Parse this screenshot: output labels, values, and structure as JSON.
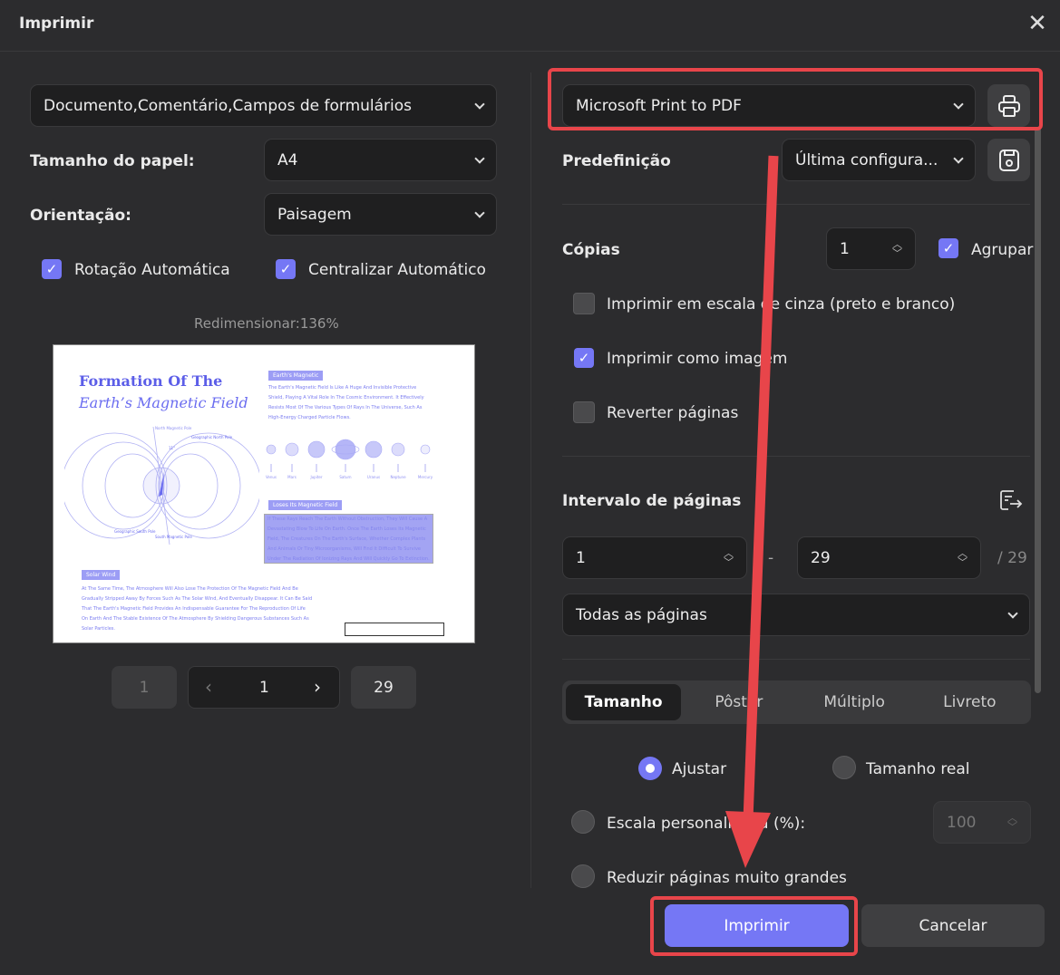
{
  "window": {
    "title": "Imprimir"
  },
  "left": {
    "content_select": "Documento,Comentário,Campos de formulários",
    "paper_size_label": "Tamanho do papel:",
    "paper_size": "A4",
    "orientation_label": "Orientação:",
    "orientation": "Paisagem",
    "auto_rotate": "Rotação Automática",
    "auto_center": "Centralizar Automático",
    "resize": "Redimensionar:136%",
    "pager": {
      "first": "1",
      "current": "1",
      "last": "29"
    }
  },
  "preview": {
    "title_line1": "Formation Of The",
    "title_line2": "Earth’s Magnetic Field",
    "tag1": "Earth's Magnetic",
    "para1": "The Earth's Magnetic Field Is Like A Huge And Invisible Protective Shield, Playing A Vital Role In The Cosmic Environment. It Effectively Resists Most Of The Various Types Of Rays In The Universe, Such As High-Energy Charged Particle Flows.",
    "planets": [
      "Venus",
      "Mars",
      "Jupiter",
      "Saturn",
      "Uranus",
      "Neptune",
      "Mercury"
    ],
    "tag2": "Loses Its Magnetic Field",
    "para2": "If These Rays Reach The Earth Without Obstruction, They Will Cause A Devastating Blow To Life On Earth. Once The Earth Loses Its Magnetic Field, The Creatures On The Earth's Surface, Whether Complex Plants And Animals Or Tiny Microorganisms, Will Find It Difficult To Survive Under The Radiation Of Ionizing Rays And Will Quickly Go To Extinction.",
    "tag3": "Solar Wind",
    "para3": "At The Same Time, The Atmosphere Will Also Lose The Protection Of The Magnetic Field And Be Gradually Stripped Away By Forces Such As The Solar Wind, And Eventually Disappear. It Can Be Said That The Earth's Magnetic Field Provides An Indispensable Guarantee For The Reproduction Of Life On Earth And The Stable Existence Of The Atmosphere By Shielding Dangerous Substances Such As Solar Particles.",
    "labels": {
      "north_mag": "North Magnetic Pole",
      "geo_north": "Geographic North Pole",
      "geo_south": "Geographic South Pole",
      "south_mag": "South Magnetic Pole",
      "angle": "11°"
    }
  },
  "right": {
    "printer": "Microsoft Print to PDF",
    "preset_label": "Predefinição",
    "preset": "Última configura...",
    "copies_label": "Cópias",
    "copies": "1",
    "collate": "Agrupar",
    "grayscale": "Imprimir em escala de cinza (preto e branco)",
    "as_image": "Imprimir como imagem",
    "reverse": "Reverter páginas",
    "range_label": "Intervalo de páginas",
    "range_from": "1",
    "range_sep": "-",
    "range_to": "29",
    "range_total": "/ 29",
    "range_select": "Todas as páginas",
    "tabs": [
      "Tamanho",
      "Pôster",
      "Múltiplo",
      "Livreto"
    ],
    "fit": "Ajustar",
    "actual": "Tamanho real",
    "custom_scale": "Escala personalizada (%):",
    "custom_scale_value": "100",
    "shrink": "Reduzir páginas muito grandes"
  },
  "buttons": {
    "print": "Imprimir",
    "cancel": "Cancelar"
  },
  "colors": {
    "accent": "#7577f5",
    "annotation": "#e8454a",
    "background": "#2c2c2e"
  }
}
